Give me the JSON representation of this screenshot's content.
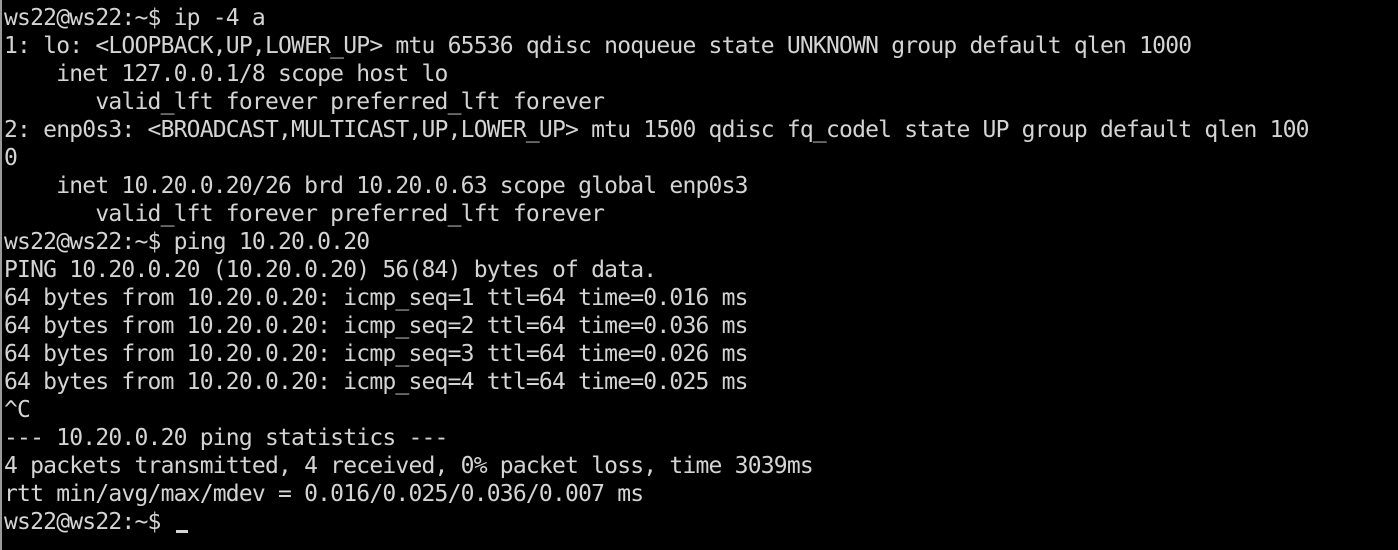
{
  "terminal": {
    "lines": [
      "ws22@ws22:~$ ip -4 a",
      "1: lo: <LOOPBACK,UP,LOWER_UP> mtu 65536 qdisc noqueue state UNKNOWN group default qlen 1000",
      "    inet 127.0.0.1/8 scope host lo",
      "       valid_lft forever preferred_lft forever",
      "2: enp0s3: <BROADCAST,MULTICAST,UP,LOWER_UP> mtu 1500 qdisc fq_codel state UP group default qlen 100",
      "0",
      "    inet 10.20.0.20/26 brd 10.20.0.63 scope global enp0s3",
      "       valid_lft forever preferred_lft forever",
      "ws22@ws22:~$ ping 10.20.0.20",
      "PING 10.20.0.20 (10.20.0.20) 56(84) bytes of data.",
      "64 bytes from 10.20.0.20: icmp_seq=1 ttl=64 time=0.016 ms",
      "64 bytes from 10.20.0.20: icmp_seq=2 ttl=64 time=0.036 ms",
      "64 bytes from 10.20.0.20: icmp_seq=3 ttl=64 time=0.026 ms",
      "64 bytes from 10.20.0.20: icmp_seq=4 ttl=64 time=0.025 ms",
      "^C",
      "--- 10.20.0.20 ping statistics ---",
      "4 packets transmitted, 4 received, 0% packet loss, time 3039ms",
      "rtt min/avg/max/mdev = 0.016/0.025/0.036/0.007 ms"
    ],
    "prompt": "ws22@ws22:~$ ",
    "colors": {
      "background": "#000000",
      "foreground": "#d4d4d4"
    }
  }
}
